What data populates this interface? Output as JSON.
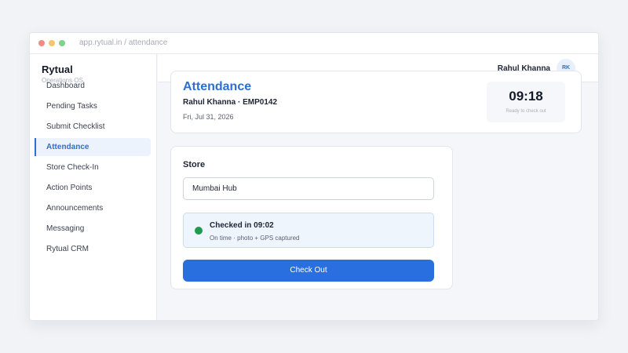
{
  "window": {
    "url": "app.rytual.in / attendance"
  },
  "sidebar": {
    "brand": "Rytual",
    "brand_sub": "Operations OS",
    "items": [
      {
        "label": "Dashboard"
      },
      {
        "label": "Pending Tasks"
      },
      {
        "label": "Submit Checklist"
      },
      {
        "label": "Attendance",
        "active": true
      },
      {
        "label": "Store Check-In"
      },
      {
        "label": "Action Points"
      },
      {
        "label": "Announcements"
      },
      {
        "label": "Messaging"
      },
      {
        "label": "Rytual CRM"
      }
    ]
  },
  "topbar": {
    "user_name": "Rahul Khanna",
    "avatar_initials": "RK"
  },
  "header": {
    "title": "Attendance",
    "employee": "Rahul Khanna · EMP0142",
    "date": "Fri, Jul 31, 2026",
    "clock": "09:18",
    "clock_status": "Ready to check out"
  },
  "store_card": {
    "label": "Store",
    "store_value": "Mumbai Hub",
    "status_title": "Checked in 09:02",
    "status_sub": "On time · photo + GPS captured",
    "checkout_label": "Check Out"
  },
  "colors": {
    "accent": "#2a6fe0",
    "status_green": "#1f9b4f"
  }
}
